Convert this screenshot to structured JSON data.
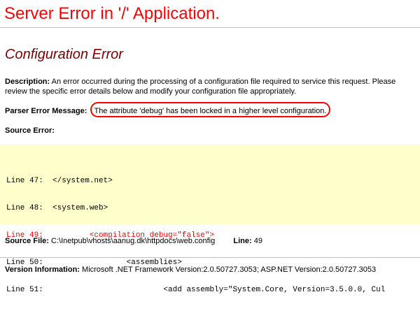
{
  "page": {
    "server_title": "Server Error in '/' Application.",
    "config_title": "Configuration Error",
    "description_label": "Description:",
    "description_text": "An error occurred during the processing of a configuration file required to service this request. Please review the specific error details below and modify your configuration file appropriately.",
    "parser_label": "Parser Error Message:",
    "parser_message": "The attribute 'debug' has been locked in a higher level configuration.",
    "source_error_label": "Source Error:",
    "source_file_label": "Source File:",
    "source_file_value": "C:\\Inetpub\\vhosts\\aanug.dk\\httpdocs\\web.config",
    "line_label": "Line:",
    "line_value": "49",
    "version_label": "Version Information:",
    "version_value": "Microsoft .NET Framework Version:2.0.50727.3053; ASP.NET Version:2.0.50727.3053"
  },
  "code": {
    "lines": [
      "Line 47:  </system.net>",
      "Line 48:  <system.web>",
      "Line 49:          <compilation debug=\"false\">",
      "Line 50:                  <assemblies>",
      "Line 51:                          <add assembly=\"System.Core, Version=3.5.0.0, Cul"
    ]
  },
  "colors": {
    "error_title": "#ff0000",
    "section_title": "#800000",
    "code_background": "#ffffcc",
    "highlight_ring": "#ff0000",
    "active_line": "#ff0000"
  }
}
